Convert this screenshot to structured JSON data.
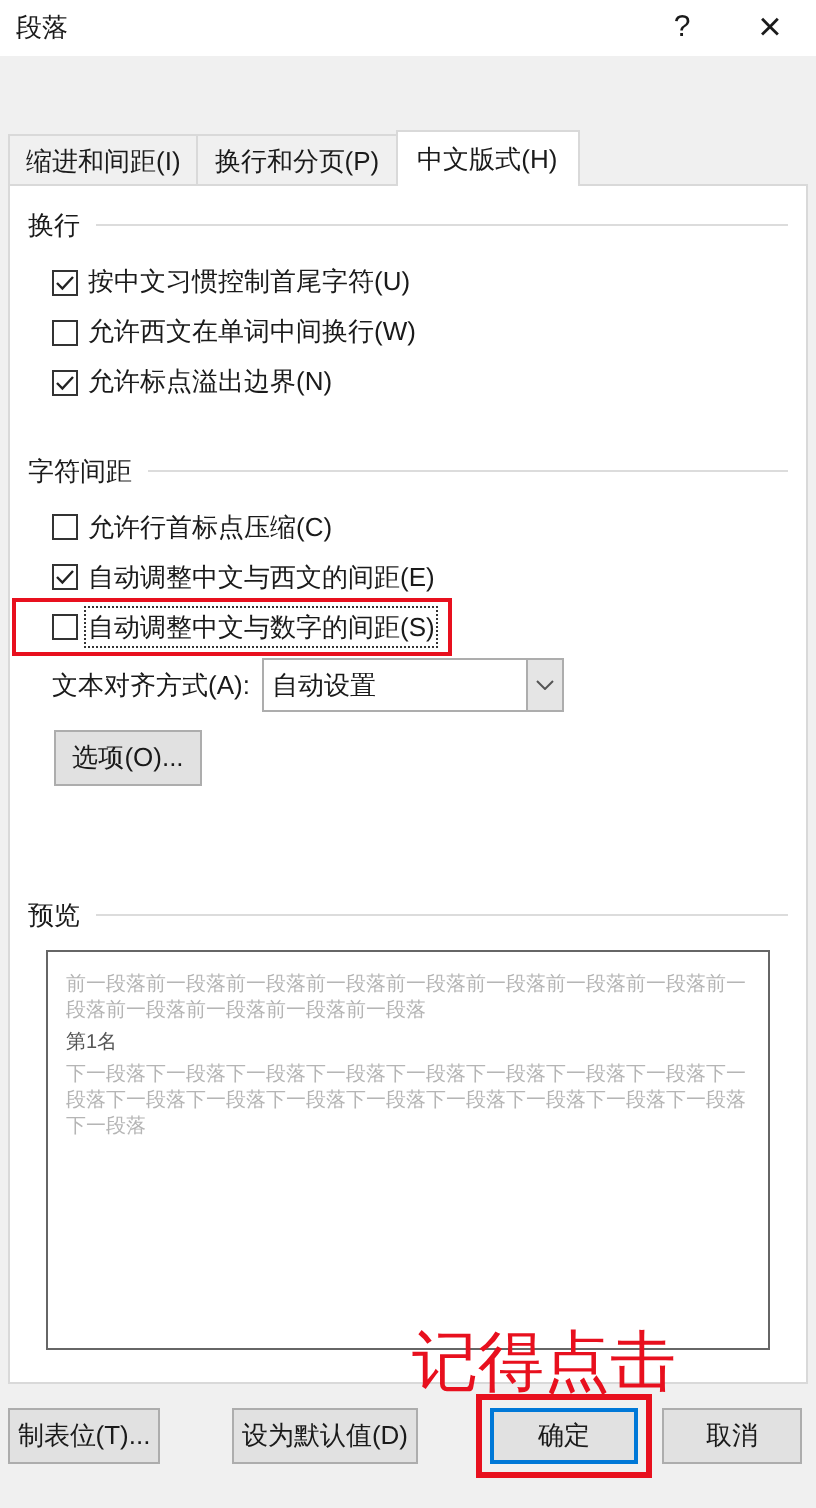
{
  "window": {
    "title": "段落",
    "help_button": "?",
    "close_button": "×"
  },
  "tabs": [
    {
      "label": "缩进和间距(I)",
      "selected": false
    },
    {
      "label": "换行和分页(P)",
      "selected": false
    },
    {
      "label": "中文版式(H)",
      "selected": true
    }
  ],
  "sections": [
    {
      "title": "换行",
      "options": [
        {
          "label": "按中文习惯控制首尾字符(U)",
          "checked": true,
          "focused": false,
          "highlighted": false
        },
        {
          "label": "允许西文在单词中间换行(W)",
          "checked": false,
          "focused": false,
          "highlighted": false
        },
        {
          "label": "允许标点溢出边界(N)",
          "checked": true,
          "focused": false,
          "highlighted": false
        }
      ]
    },
    {
      "title": "字符间距",
      "options": [
        {
          "label": "允许行首标点压缩(C)",
          "checked": false,
          "focused": false,
          "highlighted": false
        },
        {
          "label": "自动调整中文与西文的间距(E)",
          "checked": true,
          "focused": false,
          "highlighted": false
        },
        {
          "label": "自动调整中文与数字的间距(S)",
          "checked": false,
          "focused": true,
          "highlighted": true
        }
      ]
    }
  ],
  "text_alignment": {
    "label": "文本对齐方式(A):",
    "value": "自动设置"
  },
  "options_button": "选项(O)...",
  "preview": {
    "title": "预览",
    "previous_text": "前一段落前一段落前一段落前一段落前一段落前一段落前一段落前一段落前一段落前一段落前一段落前一段落前一段落",
    "sample_text": "第1名",
    "next_text": "下一段落下一段落下一段落下一段落下一段落下一段落下一段落下一段落下一段落下一段落下一段落下一段落下一段落下一段落下一段落下一段落下一段落下一段落"
  },
  "annotation": "记得点击",
  "buttons": [
    {
      "label": "制表位(T)...",
      "default": false,
      "highlighted": false
    },
    {
      "label": "设为默认值(D)",
      "default": false,
      "highlighted": false
    },
    {
      "label": "确定",
      "default": true,
      "highlighted": true
    },
    {
      "label": "取消",
      "default": false,
      "highlighted": false
    }
  ]
}
